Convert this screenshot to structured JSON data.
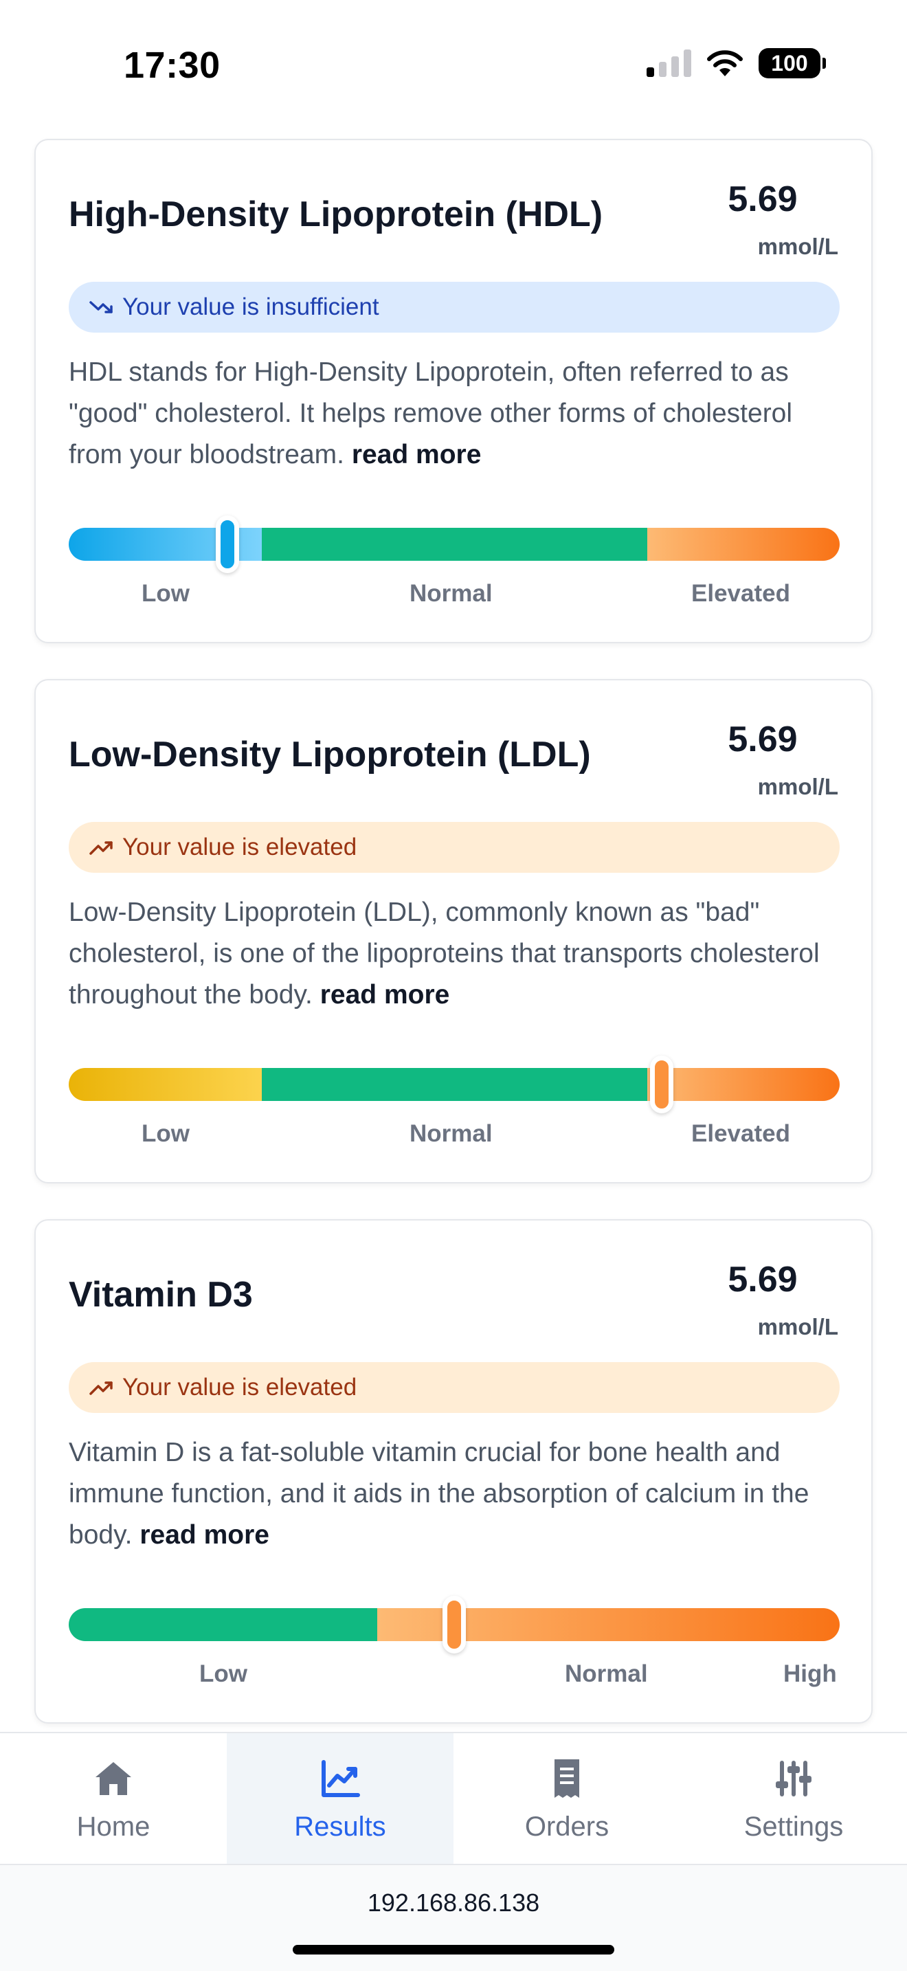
{
  "status_bar": {
    "time": "17:30",
    "battery": "100"
  },
  "cards": [
    {
      "title": "High-Density Lipoprotein (HDL)",
      "value": "5.69",
      "unit": "mmol/L",
      "status_text": "Your value is insufficient",
      "status": "insufficient",
      "description": "HDL stands for High-Density Lipoprotein, often referred to as \"good\" cholesterol. It helps remove other forms of cholesterol from your bloodstream.",
      "read_more": "read more",
      "labels": [
        "Low",
        "Normal",
        "Elevated"
      ],
      "marker_position_fraction": 0.2
    },
    {
      "title": "Low-Density Lipoprotein (LDL)",
      "value": "5.69",
      "unit": "mmol/L",
      "status_text": "Your value is elevated",
      "status": "elevated",
      "description": "Low-Density Lipoprotein (LDL), commonly known as \"bad\" cholesterol, is one of the lipoproteins that transports cholesterol throughout the body.",
      "read_more": "read more",
      "labels": [
        "Low",
        "Normal",
        "Elevated"
      ],
      "marker_position_fraction": 0.77
    },
    {
      "title": "Vitamin D3",
      "value": "5.69",
      "unit": "mmol/L",
      "status_text": "Your value is elevated",
      "status": "elevated",
      "description": "Vitamin D is a fat-soluble vitamin crucial for bone health and immune function, and it aids in the absorption of calcium in the body.",
      "read_more": "read more",
      "labels": [
        "Low",
        "Normal",
        "High"
      ],
      "marker_position_fraction": 0.5
    }
  ],
  "tabs": [
    {
      "label": "Home",
      "icon": "home-icon",
      "active": false
    },
    {
      "label": "Results",
      "icon": "chart-line-icon",
      "active": true
    },
    {
      "label": "Orders",
      "icon": "receipt-icon",
      "active": false
    },
    {
      "label": "Settings",
      "icon": "sliders-icon",
      "active": false
    }
  ],
  "url": "192.168.86.138",
  "colors": {
    "normal_green": "#10b981",
    "low_blue": "#0ea5e9",
    "low_yellow": "#eab308",
    "elevated_orange": "#f97316",
    "active_tab": "#2563eb",
    "info_pill_bg": "#dbeafe",
    "warn_pill_bg": "#ffedd5"
  }
}
